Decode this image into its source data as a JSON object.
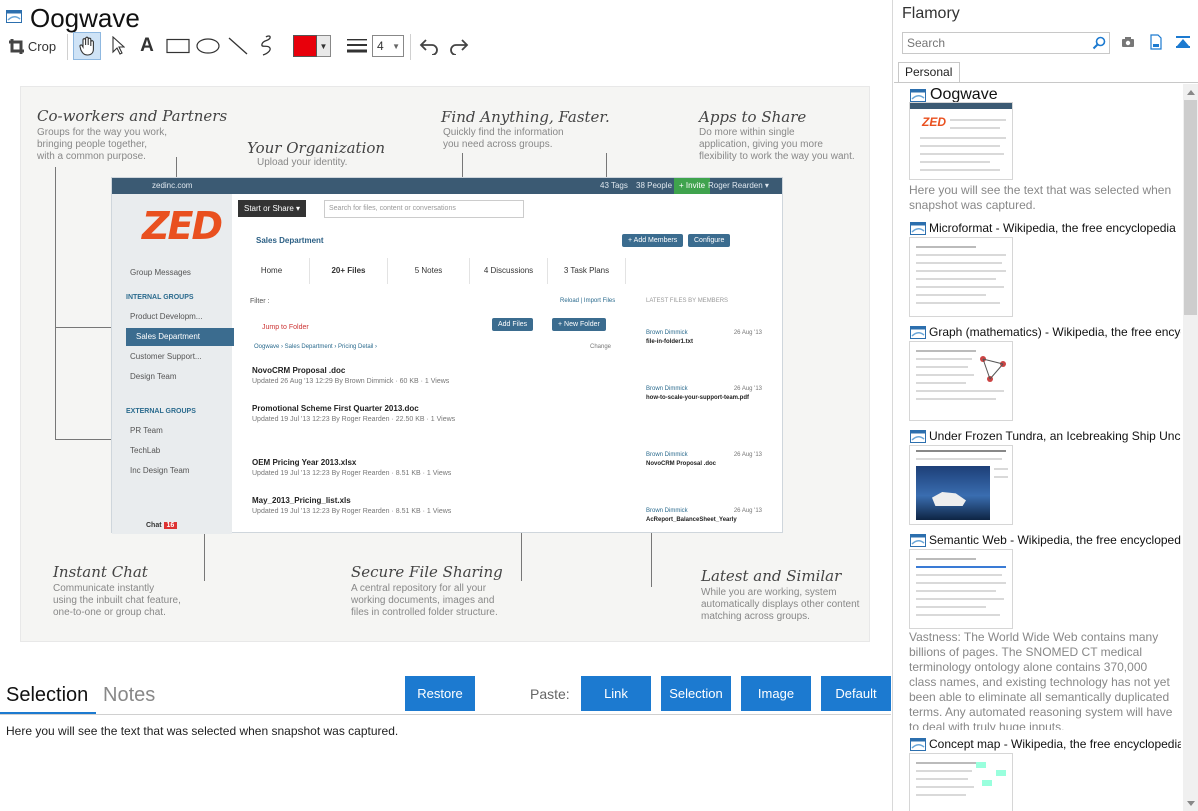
{
  "window": {
    "title": "Oogwave"
  },
  "toolbar": {
    "crop_label": "Crop",
    "line_width": "4",
    "color": "#e8000b"
  },
  "screenshot": {
    "annotations": {
      "coworkers_title": "Co-workers and Partners",
      "coworkers_text": [
        "Groups for the way you work,",
        "bringing people together,",
        "with a common purpose."
      ],
      "org_title": "Your Organization",
      "org_text": [
        "Upload your identity."
      ],
      "find_title": "Find Anything, Faster.",
      "find_text": [
        "Quickly find the information",
        "you need across groups."
      ],
      "apps_title": "Apps to Share",
      "apps_text": [
        "Do more within single",
        "application, giving you more",
        "flexibility to work the way you want."
      ],
      "chat_title": "Instant Chat",
      "chat_text": [
        "Communicate instantly",
        "using the inbuilt chat feature,",
        "one-to-one or group chat."
      ],
      "share_title": "Secure File Sharing",
      "share_text": [
        "A central repository for all your",
        "working documents, images and",
        "files in controlled folder structure."
      ],
      "latest_title": "Latest and Similar",
      "latest_text": [
        "While you are working, system",
        "automatically displays other content",
        "matching across groups."
      ]
    },
    "app": {
      "domain": "zedinc.com",
      "top_right": [
        "43 Tags",
        "38 People",
        "+ Invite",
        "Roger Rearden ▾"
      ],
      "logo": "ZED",
      "start_share": "Start or Share ▾",
      "search_placeholder": "Search for files, content or conversations",
      "dept": "Sales Department",
      "add_members": "+ Add Members",
      "configure": "Configure",
      "tabs": [
        "Home",
        "20+ Files",
        "5 Notes",
        "4 Discussions",
        "3 Task Plans"
      ],
      "side_items": [
        "Group Messages"
      ],
      "internal_head": "INTERNAL GROUPS",
      "internal": [
        "Product Developm...",
        "Sales Department",
        "Customer Support...",
        "Design Team"
      ],
      "external_head": "EXTERNAL GROUPS",
      "external": [
        "PR Team",
        "TechLab",
        "Inc Design Team"
      ],
      "chat": "Chat",
      "chat_count": "16",
      "filter": "Filter :",
      "reload": "Reload | Import Files",
      "jump": "Jump to Folder",
      "add_files": "Add Files",
      "new_folder": "+ New Folder",
      "breadcrumb": "Oogwave › Sales Department › Pricing Detail ›",
      "change": "Change",
      "files": [
        {
          "name": "NovoCRM Proposal .doc",
          "meta": "Updated 26 Aug '13 12:29 By Brown Dimmick · 60 KB · 1 Views"
        },
        {
          "name": "Promotional Scheme First Quarter 2013.doc",
          "meta": "Updated 19 Jul '13 12:23 By Roger Rearden · 22.50 KB · 1 Views"
        },
        {
          "name": "OEM Pricing Year 2013.xlsx",
          "meta": "Updated 19 Jul '13 12:23 By Roger Rearden · 8.51 KB · 1 Views"
        },
        {
          "name": "May_2013_Pricing_list.xls",
          "meta": "Updated 19 Jul '13 12:23 By Roger Rearden · 8.51 KB · 1 Views"
        }
      ],
      "latest_head": "LATEST FILES BY MEMBERS",
      "latest": [
        {
          "who": "Brown Dimmick",
          "date": "26 Aug '13",
          "file": "file-in-folder1.txt"
        },
        {
          "who": "Brown Dimmick",
          "date": "26 Aug '13",
          "file": "how-to-scale-your-support-team.pdf"
        },
        {
          "who": "Brown Dimmick",
          "date": "26 Aug '13",
          "file": "NovoCRM Proposal .doc"
        },
        {
          "who": "Brown Dimmick",
          "date": "26 Aug '13",
          "file": "AcReport_BalanceSheet_Yearly"
        }
      ]
    }
  },
  "bottom": {
    "tab_selection": "Selection",
    "tab_notes": "Notes",
    "restore": "Restore",
    "paste_label": "Paste:",
    "paste_buttons": [
      "Link",
      "Selection",
      "Image",
      "Default"
    ],
    "selection_text": "Here you will see the text that was selected when snapshot was captured."
  },
  "sidebar": {
    "brand": "Flamory",
    "search_placeholder": "Search",
    "tab_personal": "Personal",
    "entries": [
      {
        "title": "Oogwave",
        "desc": "Here you will see the text that was selected when snapshot was captured."
      },
      {
        "title": "Microformat - Wikipedia, the free encyclopedia"
      },
      {
        "title": "Graph (mathematics) - Wikipedia, the free encyclopedia"
      },
      {
        "title": "Under Frozen Tundra, an Icebreaking Ship Uncovers"
      },
      {
        "title": "Semantic Web - Wikipedia, the free encyclopedia",
        "desc": "Vastness: The World Wide Web contains many billions of pages. The SNOMED CT medical terminology ontology alone contains 370,000 class names, and existing technology has not yet been able to eliminate all semantically duplicated terms. Any automated reasoning system will have to deal with truly huge inputs."
      },
      {
        "title": "Concept map - Wikipedia, the free encyclopedia"
      }
    ]
  },
  "colors": {
    "accent": "#1c7ad0",
    "brand_orange": "#e9501f",
    "app_nav": "#3b5a73"
  }
}
